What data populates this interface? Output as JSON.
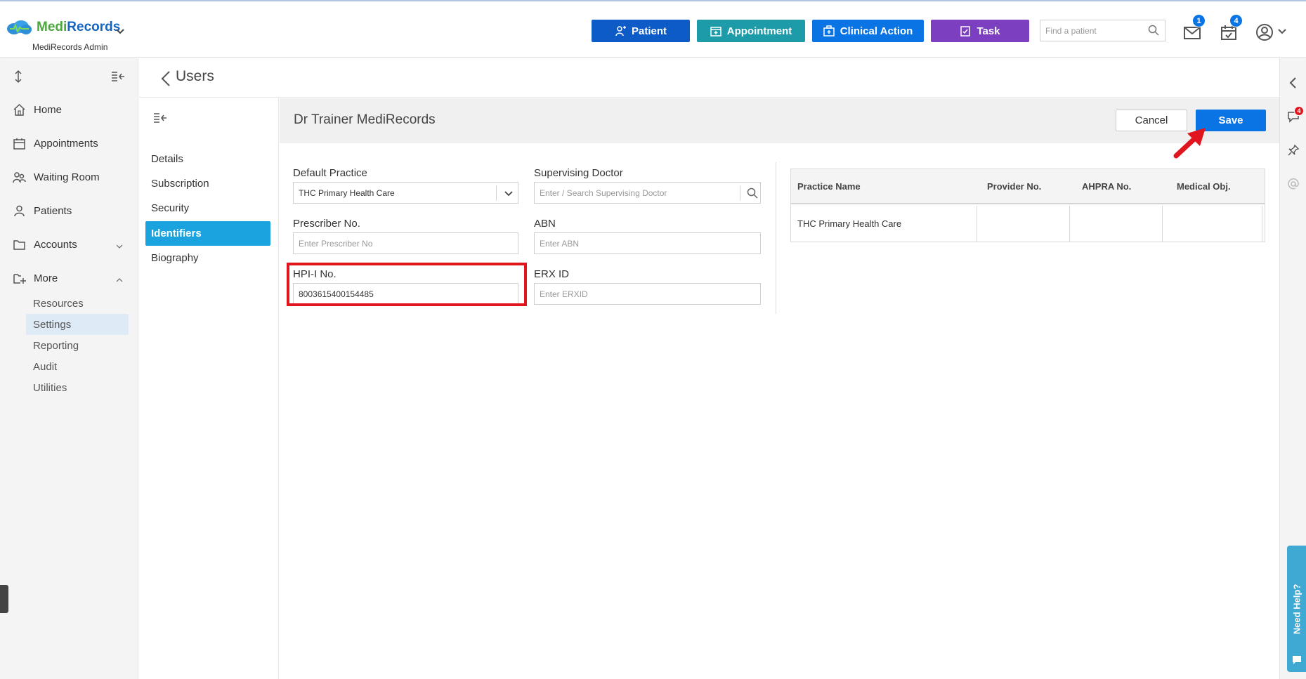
{
  "app": {
    "brand_part1": "Medi",
    "brand_part2": "Records",
    "subtitle": "MediRecords Admin"
  },
  "topbar": {
    "buttons": [
      "Patient",
      "Appointment",
      "Clinical Action",
      "Task"
    ],
    "search_placeholder": "Find a patient",
    "mail_badge": "1",
    "calendar_badge": "4"
  },
  "sidebar": {
    "items": [
      "Home",
      "Appointments",
      "Waiting Room",
      "Patients",
      "Accounts",
      "More"
    ],
    "more_children": [
      "Resources",
      "Settings",
      "Reporting",
      "Audit",
      "Utilities"
    ],
    "active_child": "Settings"
  },
  "page": {
    "title": "Users"
  },
  "tabs": {
    "items": [
      "Details",
      "Subscription",
      "Security",
      "Identifiers",
      "Biography"
    ],
    "active": "Identifiers"
  },
  "content": {
    "user_name": "Dr Trainer MediRecords",
    "cancel_label": "Cancel",
    "save_label": "Save",
    "fields": {
      "default_practice": {
        "label": "Default Practice",
        "value": "THC Primary Health Care"
      },
      "supervising_doctor": {
        "label": "Supervising Doctor",
        "placeholder": "Enter / Search Supervising Doctor"
      },
      "prescriber_no": {
        "label": "Prescriber No.",
        "placeholder": "Enter Prescriber No"
      },
      "abn": {
        "label": "ABN",
        "placeholder": "Enter ABN"
      },
      "hpii_no": {
        "label": "HPI-I No.",
        "value": "8003615400154485"
      },
      "erx_id": {
        "label": "ERX ID",
        "placeholder": "Enter ERXID"
      }
    },
    "table": {
      "columns": [
        "Practice Name",
        "Provider No.",
        "AHPRA No.",
        "Medical Obj."
      ],
      "rows": [
        [
          "THC Primary Health Care",
          "",
          "",
          ""
        ]
      ]
    }
  },
  "right_rail": {
    "notification_badge": "4",
    "help_label": "Need Help?"
  },
  "colors": {
    "patient_btn": "#0d5bc6",
    "appointment_btn": "#1d9ba8",
    "clinical_btn": "#0a74e5",
    "task_btn": "#7b3fbf",
    "active_tab": "#1aa3df",
    "highlight": "#e0151e"
  }
}
